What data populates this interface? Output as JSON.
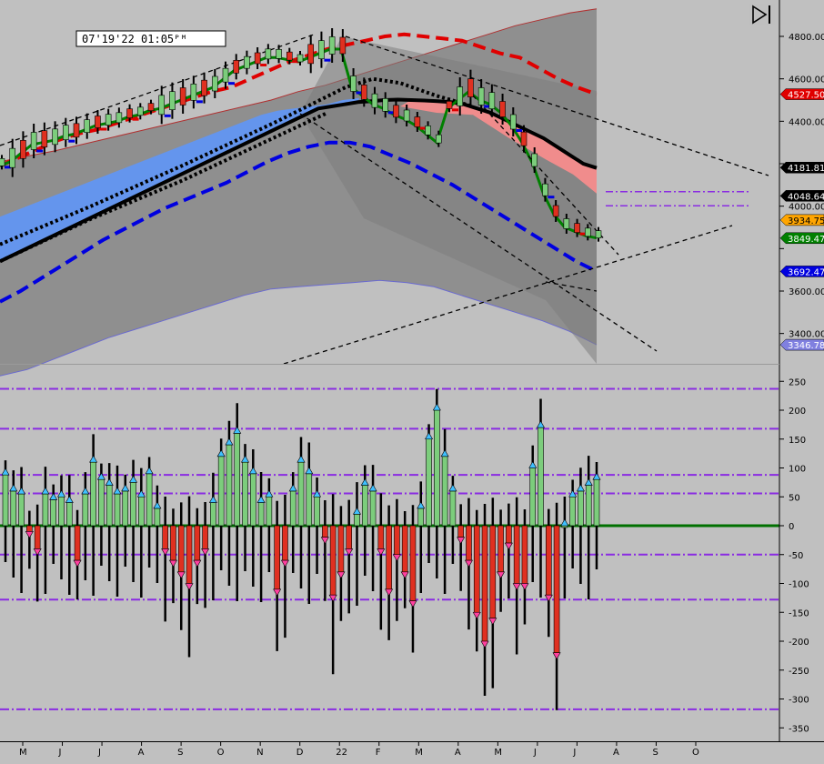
{
  "window": {
    "timestamp": "07'19'22  01:05ᴾᴹ"
  },
  "toolbar": {
    "icon": "skip-to-end-icon"
  },
  "colors": {
    "background": "#c0c0c0",
    "band_outer": "#8f8f8f",
    "band_inner": "#7d7d7d",
    "cloud_blue": "#6495ed",
    "cloud_red": "#f08c8c",
    "ema_green": "#008000",
    "upper_red": "#e00000",
    "lower_blue": "#0000e0",
    "up_bar": "#7ccd7c",
    "down_bar": "#e03020",
    "guide_purple": "#8a2be2",
    "zero_line": "#007000"
  },
  "chart_data": [
    {
      "type": "line",
      "title": "",
      "ylim": [
        3200,
        4930
      ],
      "y_ticks": [
        {
          "value": 4800,
          "label": "4800.00"
        },
        {
          "value": 4600,
          "label": "4600.00"
        },
        {
          "value": 4400,
          "label": "4400.00"
        },
        {
          "value": 4200,
          "label": ""
        },
        {
          "value": 4000,
          "label": "4000.00"
        },
        {
          "value": 3800,
          "label": ""
        },
        {
          "value": 3600,
          "label": "3600.00"
        },
        {
          "value": 3400,
          "label": "3400.00"
        }
      ],
      "x_ticks": [
        "M",
        "J",
        "J",
        "A",
        "S",
        "O",
        "N",
        "D",
        "22",
        "F",
        "M",
        "A",
        "M",
        "J",
        "J",
        "A",
        "S",
        "O"
      ],
      "price_tags": [
        {
          "value": 4527.5,
          "label": "4527.50",
          "bg": "#e00000",
          "fg": "#ffffff"
        },
        {
          "value": 4181.81,
          "label": "4181.81",
          "bg": "#000000",
          "fg": "#ffffff"
        },
        {
          "value": 4048.64,
          "label": "4048.64",
          "bg": "#000000",
          "fg": "#ffffff"
        },
        {
          "value": 3934.75,
          "label": "3934.75",
          "bg": "#ffa500",
          "fg": "#000000"
        },
        {
          "value": 3849.47,
          "label": "3849.47",
          "bg": "#008000",
          "fg": "#ffffff"
        },
        {
          "value": 3692.47,
          "label": "3692.47",
          "bg": "#0000e0",
          "fg": "#ffffff"
        },
        {
          "value": 3346.78,
          "label": "3346.78",
          "bg": "#8080e0",
          "fg": "#ffffff"
        }
      ],
      "levels": [
        4068,
        4002
      ],
      "series": [
        {
          "role": "band_top",
          "values": [
            4210,
            4235,
            4260,
            4290,
            4320,
            4350,
            4380,
            4410,
            4440,
            4470,
            4500,
            4540,
            4570,
            4610,
            4650,
            4690,
            4730,
            4770,
            4810,
            4850,
            4880,
            4910,
            4930
          ]
        },
        {
          "role": "cloud_blue_top",
          "values": [
            3950,
            3980,
            4010,
            4040,
            4070,
            4100,
            4130,
            4160,
            4190,
            4220,
            4250,
            4280,
            4310,
            4340,
            4370,
            4400,
            4430,
            4450,
            4460,
            4470,
            4480,
            4500,
            4510
          ]
        },
        {
          "role": "sma_black",
          "values": [
            3740,
            3770,
            3800,
            3830,
            3860,
            3890,
            3920,
            3950,
            3980,
            4010,
            4040,
            4070,
            4100,
            4130,
            4160,
            4190,
            4220,
            4250,
            4280,
            4310,
            4340,
            4370,
            4400,
            4430,
            4460,
            4470,
            4480,
            4490,
            4495,
            4500,
            4502,
            4500,
            4498,
            4495,
            4490,
            4480,
            4460,
            4440,
            4410,
            4380,
            4350,
            4320,
            4280,
            4240,
            4200,
            4180
          ]
        },
        {
          "role": "ema_green",
          "values": [
            4190,
            4210,
            4250,
            4290,
            4300,
            4310,
            4330,
            4340,
            4360,
            4380,
            4390,
            4400,
            4420,
            4430,
            4450,
            4460,
            4480,
            4500,
            4520,
            4540,
            4560,
            4600,
            4640,
            4660,
            4680,
            4700,
            4700,
            4690,
            4680,
            4700,
            4720,
            4740,
            4740,
            4560,
            4520,
            4480,
            4460,
            4430,
            4410,
            4380,
            4340,
            4300,
            4460,
            4500,
            4540,
            4500,
            4480,
            4440,
            4380,
            4300,
            4200,
            4060,
            3960,
            3900,
            3880,
            3860,
            3850
          ]
        },
        {
          "role": "upper_red",
          "values": [
            4190,
            4230,
            4270,
            4310,
            4340,
            4360,
            4390,
            4420,
            4450,
            4480,
            4510,
            4540,
            4560,
            4600,
            4640,
            4680,
            4710,
            4740,
            4760,
            4780,
            4800,
            4810,
            4800,
            4790,
            4780,
            4750,
            4720,
            4700,
            4650,
            4600,
            4560,
            4527.5
          ]
        },
        {
          "role": "lower_blue",
          "values": [
            3550,
            3600,
            3660,
            3720,
            3780,
            3840,
            3890,
            3940,
            3990,
            4030,
            4070,
            4110,
            4160,
            4210,
            4250,
            4280,
            4300,
            4300,
            4280,
            4240,
            4200,
            4150,
            4100,
            4040,
            3980,
            3920,
            3860,
            3800,
            3740,
            3692.47
          ]
        },
        {
          "role": "band_bottom",
          "values": [
            3200,
            3230,
            3280,
            3330,
            3380,
            3420,
            3460,
            3500,
            3540,
            3580,
            3610,
            3620,
            3630,
            3640,
            3650,
            3640,
            3620,
            3580,
            3540,
            3500,
            3460,
            3410,
            3346.78
          ]
        }
      ]
    },
    {
      "type": "bar",
      "title": "",
      "ylim": [
        -370,
        250
      ],
      "y_ticks": [
        250,
        200,
        150,
        100,
        50,
        0,
        -50,
        -100,
        -150,
        -200,
        -250,
        -300,
        -350
      ],
      "guides": [
        237,
        168,
        88,
        56,
        -50,
        -128,
        -318
      ],
      "values": [
        88,
        60,
        55,
        -10,
        -40,
        55,
        45,
        50,
        40,
        -60,
        55,
        110,
        80,
        70,
        55,
        60,
        75,
        50,
        90,
        30,
        -40,
        -60,
        -80,
        -100,
        -60,
        -40,
        40,
        120,
        140,
        160,
        110,
        90,
        40,
        50,
        -110,
        -60,
        60,
        110,
        90,
        50,
        -20,
        -120,
        -80,
        -40,
        20,
        70,
        60,
        -40,
        -110,
        -50,
        -80,
        -130,
        30,
        150,
        200,
        120,
        60,
        -20,
        -60,
        -150,
        -200,
        -160,
        -80,
        -30,
        -100,
        -100,
        100,
        170,
        -120,
        -220,
        0,
        50,
        60,
        70,
        80
      ]
    }
  ]
}
